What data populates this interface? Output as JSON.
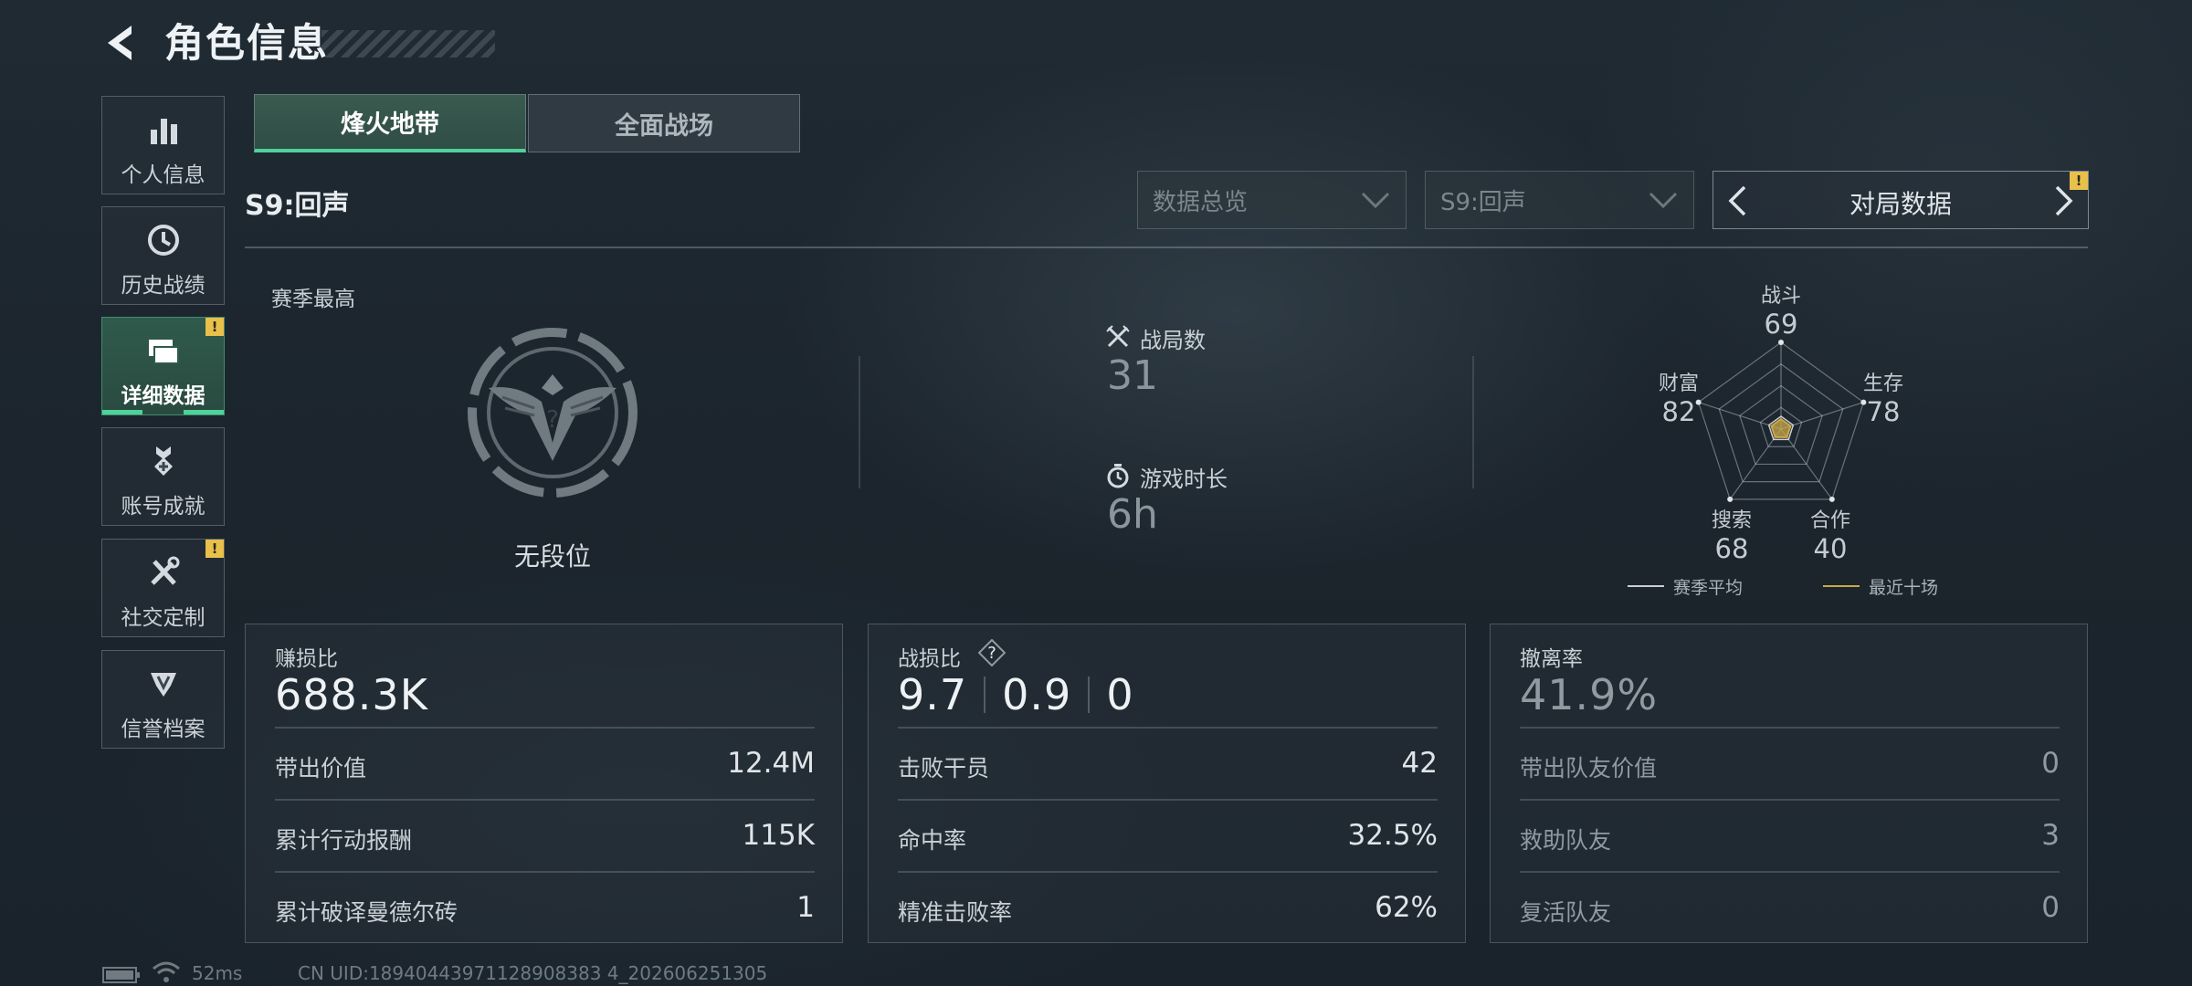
{
  "header": {
    "title": "角色信息"
  },
  "sidebar": {
    "items": [
      {
        "label": "个人信息",
        "icon": "bar-chart-icon"
      },
      {
        "label": "历史战绩",
        "icon": "history-clock-icon"
      },
      {
        "label": "详细数据",
        "icon": "folders-icon",
        "active": true,
        "badge": "!"
      },
      {
        "label": "账号成就",
        "icon": "medal-icon"
      },
      {
        "label": "社交定制",
        "icon": "tools-icon",
        "badge": "!"
      },
      {
        "label": "信誉档案",
        "icon": "shield-emblem-icon"
      }
    ]
  },
  "mode_tabs": [
    {
      "label": "烽火地带",
      "active": true
    },
    {
      "label": "全面战场",
      "active": false
    }
  ],
  "season_label": "S9:回声",
  "filters": {
    "overview_dropdown": "数据总览",
    "season_dropdown": "S9:回声",
    "match_nav_label": "对局数据",
    "match_nav_badge": "!"
  },
  "overview": {
    "season_best_label": "赛季最高",
    "rank_text": "无段位",
    "matches_label": "战局数",
    "matches_value": "31",
    "playtime_label": "游戏时长",
    "playtime_value": "6h"
  },
  "radar": {
    "axes": [
      {
        "label": "战斗",
        "value": "69"
      },
      {
        "label": "生存",
        "value": "78"
      },
      {
        "label": "合作",
        "value": "40"
      },
      {
        "label": "搜索",
        "value": "68"
      },
      {
        "label": "财富",
        "value": "82"
      }
    ],
    "legend": [
      {
        "label": "赛季平均",
        "color": "#c8ced2"
      },
      {
        "label": "最近十场",
        "color": "#c9a94a"
      }
    ]
  },
  "panels": {
    "profit": {
      "title": "赚损比",
      "big_value": "688.3K",
      "rows": [
        {
          "label": "带出价值",
          "value": "12.4M"
        },
        {
          "label": "累计行动报酬",
          "value": "115K"
        },
        {
          "label": "累计破译曼德尔砖",
          "value": "1"
        }
      ]
    },
    "combat": {
      "title": "战损比",
      "values": [
        "9.7",
        "0.9",
        "0"
      ],
      "rows": [
        {
          "label": "击败干员",
          "value": "42"
        },
        {
          "label": "命中率",
          "value": "32.5%"
        },
        {
          "label": "精准击败率",
          "value": "62%"
        }
      ]
    },
    "extract": {
      "title": "撤离率",
      "big_value": "41.9%",
      "rows": [
        {
          "label": "带出队友价值",
          "value": "0"
        },
        {
          "label": "救助队友",
          "value": "3"
        },
        {
          "label": "复活队友",
          "value": "0"
        }
      ]
    }
  },
  "footer": {
    "ping": "52ms",
    "uid": "CN UID:18940443971128908383 4_202606251305"
  },
  "colors": {
    "accent": "#4fd29a",
    "badge": "#e8c04a"
  }
}
